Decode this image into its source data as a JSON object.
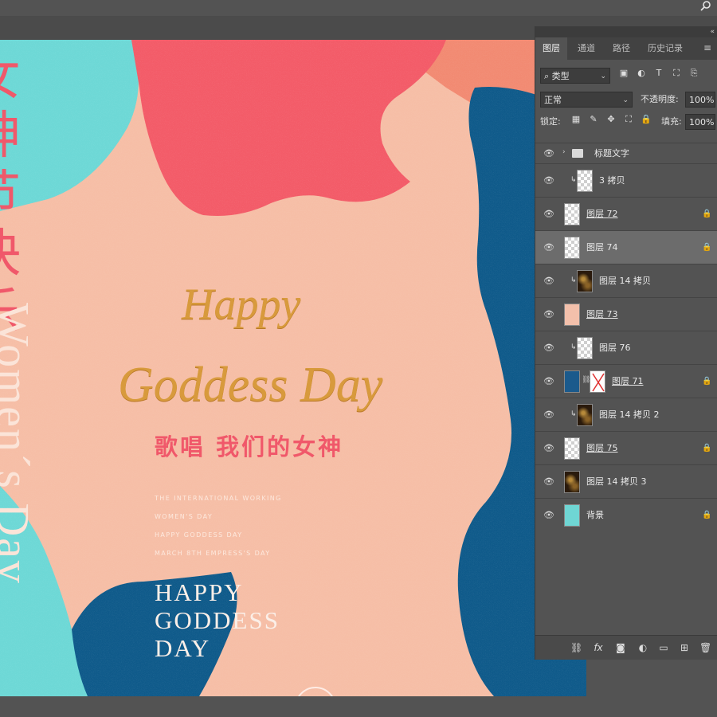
{
  "panel": {
    "tabs": [
      "图层",
      "通道",
      "路径",
      "历史记录"
    ],
    "active_tab": "图层",
    "filter": {
      "kind": "类型"
    },
    "blend_mode": "正常",
    "opacity_label": "不透明度:",
    "opacity_value": "100%",
    "lock_label": "锁定:",
    "fill_label": "填充:",
    "fill_value": "100%",
    "layers": [
      {
        "name": "标题文字",
        "type": "group",
        "locked": false
      },
      {
        "name": "3 拷贝",
        "clipped": true,
        "thumb": "transparent",
        "locked": false
      },
      {
        "name": "图层 72",
        "thumb": "transparent",
        "locked": true
      },
      {
        "name": "图层 74",
        "thumb": "transparent",
        "locked": true,
        "selected": true
      },
      {
        "name": "图层 14 拷贝",
        "clipped": true,
        "thumb": "gold",
        "locked": false
      },
      {
        "name": "图层 73",
        "thumb": "pink",
        "locked": false
      },
      {
        "name": "图层 76",
        "clipped": true,
        "thumb": "transparent",
        "locked": false
      },
      {
        "name": "图层 71",
        "thumb": "blue",
        "mask": true,
        "locked": true
      },
      {
        "name": "图层 14 拷贝 2",
        "clipped": true,
        "thumb": "gold",
        "locked": false
      },
      {
        "name": "图层 75",
        "thumb": "transparent",
        "locked": true
      },
      {
        "name": "图层 14 拷贝 3",
        "thumb": "gold",
        "locked": false
      },
      {
        "name": "背景",
        "thumb": "teal",
        "locked": true
      }
    ]
  },
  "canvas": {
    "vertical_cn": "女神节快乐",
    "vertical_en": "Women´s Day",
    "script_line1": "Happy",
    "script_line2": "Goddess Day",
    "cn_title": "歌唱 我们的女神",
    "small_lines": [
      "THE INTERNATIONAL WORKING",
      "WOMEN'S DAY",
      "HAPPY GODDESS DAY",
      "MARCH 8TH EMPRESS'S DAY"
    ],
    "big_en": [
      "HAPPY",
      "GODDESS",
      "DAY"
    ]
  },
  "colors": {
    "peach": "#f6bea6",
    "teal": "#6dd8d6",
    "coral": "#f35b68",
    "navy": "#0f5a8a",
    "gold": "#d89a3c",
    "ui_bg": "#535353"
  }
}
